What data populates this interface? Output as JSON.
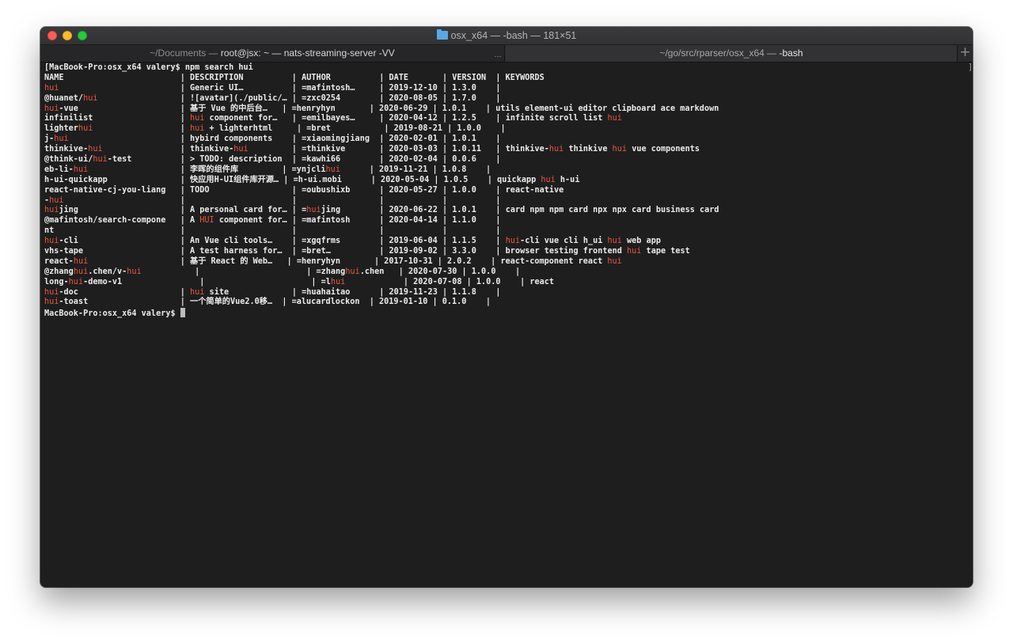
{
  "window": {
    "title": "osx_x64 — -bash — 181×51",
    "tabs": [
      {
        "label_plain": "~/Documents — ",
        "label_bold": "root@jsx: ~ — nats-streaming-server -VV",
        "overflow": "..."
      },
      {
        "label_plain": "~/go/src/rparser/osx_x64 — ",
        "label_bold": "-bash"
      }
    ],
    "add_tab": "+"
  },
  "terminal": {
    "highlight_color": "#e8553e",
    "lines": [
      [
        {
          "t": "[MacBook-Pro:osx_x64 valery$ npm search hui"
        }
      ],
      [
        {
          "t": "NAME                        | DESCRIPTION          | AUTHOR          | DATE       | VERSION  | KEYWORDS"
        }
      ],
      [
        {
          "t": "hui",
          "h": true
        },
        {
          "t": "                         | Generic UI…          | =mafintosh…     | 2019-12-10 | 1.3.0    |"
        }
      ],
      [
        {
          "t": "@huanet/"
        },
        {
          "t": "hui",
          "h": true
        },
        {
          "t": "                 | ![avatar](./public/… | =zxc0254        | 2020-08-05 | 1.7.0    |"
        }
      ],
      [
        {
          "t": "hui",
          "h": true
        },
        {
          "t": "-vue                     | 基于 Vue 的中后台…   | =henryhyn       | 2020-06-29 | 1.0.1    | utils element-ui editor clipboard ace markdown"
        }
      ],
      [
        {
          "t": "infinilist                  | "
        },
        {
          "t": "hui",
          "h": true
        },
        {
          "t": " component for…   | =emilbayes…     | 2020-04-12 | 1.2.5    | infinite scroll list "
        },
        {
          "t": "hui",
          "h": true
        }
      ],
      [
        {
          "t": "lighter"
        },
        {
          "t": "hui",
          "h": true
        },
        {
          "t": "                  | "
        },
        {
          "t": "hui",
          "h": true
        },
        {
          "t": " + lighterhtml     | =bret           | 2019-08-21 | 1.0.0    |"
        }
      ],
      [
        {
          "t": "j-"
        },
        {
          "t": "hui",
          "h": true
        },
        {
          "t": "                       | hybird components    | =xiaomingjiang  | 2020-02-01 | 1.0.1    |"
        }
      ],
      [
        {
          "t": "thinkive-"
        },
        {
          "t": "hui",
          "h": true
        },
        {
          "t": "                | thinkive-"
        },
        {
          "t": "hui",
          "h": true
        },
        {
          "t": "         | =thinkive       | 2020-03-03 | 1.0.11   | thinkive-"
        },
        {
          "t": "hui",
          "h": true
        },
        {
          "t": " thinkive "
        },
        {
          "t": "hui",
          "h": true
        },
        {
          "t": " vue components"
        }
      ],
      [
        {
          "t": "@think-ui/"
        },
        {
          "t": "hui",
          "h": true
        },
        {
          "t": "-test          | > TODO: description  | =kawhi66        | 2020-02-04 | 0.0.6    |"
        }
      ],
      [
        {
          "t": "eb-li-"
        },
        {
          "t": "hui",
          "h": true
        },
        {
          "t": "                   | 李晖的组件库         | =ynjcli"
        },
        {
          "t": "hui",
          "h": true
        },
        {
          "t": "      | 2019-11-21 | 1.0.8    |"
        }
      ],
      [
        {
          "t": "h-ui-quickapp               | 快应用H-UI组件库开源… | =h-ui.mobi      | 2020-05-04 | 1.0.5    | quickapp "
        },
        {
          "t": "hui",
          "h": true
        },
        {
          "t": " h-ui"
        }
      ],
      [
        {
          "t": "react-native-cj-you-liang   | TODO                 | =oubushixb      | 2020-05-27 | 1.0.0    | react-native"
        }
      ],
      [
        {
          "t": "-"
        },
        {
          "t": "hui",
          "h": true
        },
        {
          "t": "                        |                      |                 |            |          |"
        }
      ],
      [
        {
          "t": "hui",
          "h": true
        },
        {
          "t": "jing                     | A personal card for… | ="
        },
        {
          "t": "hui",
          "h": true
        },
        {
          "t": "jing        | 2020-06-22 | 1.0.1    | card npm npm card npx npx card business card"
        }
      ],
      [
        {
          "t": "@mafintosh/search-compone   | A "
        },
        {
          "t": "HUI",
          "h": true
        },
        {
          "t": " component for… | =mafintosh      | 2020-04-14 | 1.1.0    |"
        }
      ],
      [
        {
          "t": "nt                          |                      |                 |            |          |"
        }
      ],
      [
        {
          "t": "hui",
          "h": true
        },
        {
          "t": "-cli                     | An Vue cli tools…    | =xgqfrms        | 2019-06-04 | 1.1.5    | "
        },
        {
          "t": "hui",
          "h": true
        },
        {
          "t": "-cli vue cli h_ui "
        },
        {
          "t": "hui",
          "h": true
        },
        {
          "t": " web app"
        }
      ],
      [
        {
          "t": "vhs-tape                    | A test harness for…  | =bret…          | 2019-09-02 | 3.3.0    | browser testing frontend "
        },
        {
          "t": "hui",
          "h": true
        },
        {
          "t": " tape test"
        }
      ],
      [
        {
          "t": "react-"
        },
        {
          "t": "hui",
          "h": true
        },
        {
          "t": "                   | 基于 React 的 Web…   | =henryhyn       | 2017-10-31 | 2.0.2    | react-component react "
        },
        {
          "t": "hui",
          "h": true
        }
      ],
      [
        {
          "t": "@zhang"
        },
        {
          "t": "hui",
          "h": true
        },
        {
          "t": ".chen/v-"
        },
        {
          "t": "hui",
          "h": true
        },
        {
          "t": "           |                      | =zhang"
        },
        {
          "t": "hui",
          "h": true
        },
        {
          "t": ".chen   | 2020-07-30 | 1.0.0    |"
        }
      ],
      [
        {
          "t": "long-"
        },
        {
          "t": "hui",
          "h": true
        },
        {
          "t": "-demo-v1                |                      | =l"
        },
        {
          "t": "hui",
          "h": true
        },
        {
          "t": "            | 2020-07-08 | 1.0.0    | react"
        }
      ],
      [
        {
          "t": "hui",
          "h": true
        },
        {
          "t": "-doc                     | "
        },
        {
          "t": "hui",
          "h": true
        },
        {
          "t": " site             | =huahaitao      | 2019-11-23 | 1.1.8    |"
        }
      ],
      [
        {
          "t": "hui",
          "h": true
        },
        {
          "t": "-toast                   | 一个简单的Vue2.0移…  | =alucardlockon  | 2019-01-10 | 0.1.0    |"
        }
      ],
      [
        {
          "t": "MacBook-Pro:osx_x64 valery$ "
        }
      ]
    ],
    "right_bracket": "]"
  }
}
